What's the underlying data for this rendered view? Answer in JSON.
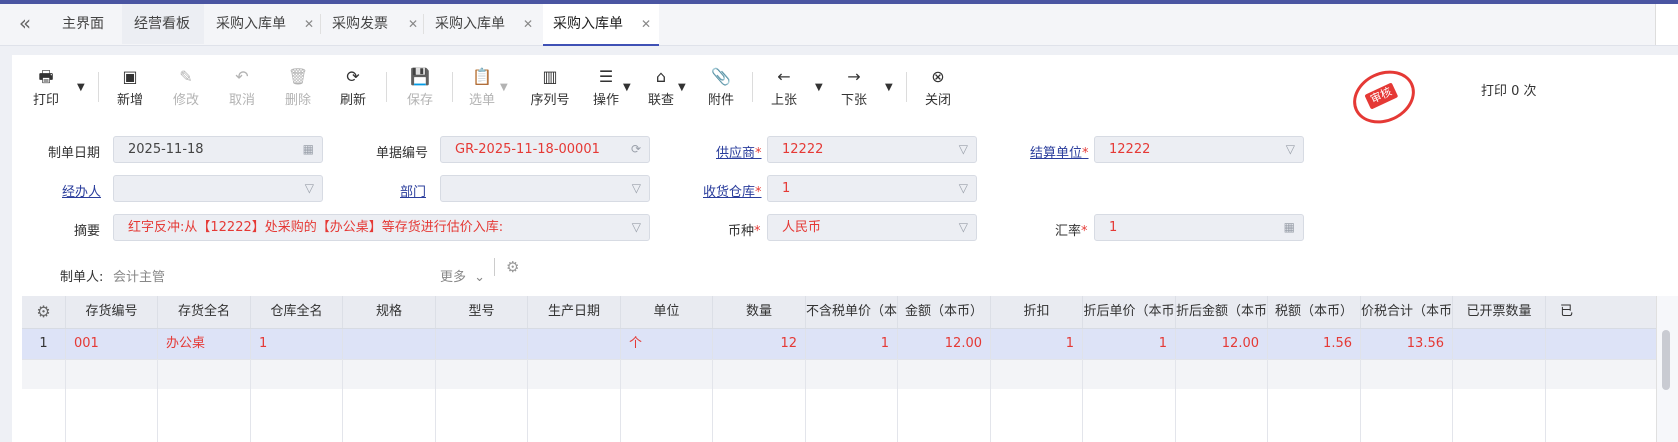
{
  "tabs": [
    {
      "label": "主界面",
      "closable": false,
      "active": false
    },
    {
      "label": "经营看板",
      "closable": false,
      "active": false
    },
    {
      "label": "采购入库单",
      "closable": true,
      "active": false
    },
    {
      "label": "采购发票",
      "closable": true,
      "active": false
    },
    {
      "label": "采购入库单",
      "closable": true,
      "active": false
    },
    {
      "label": "采购入库单",
      "closable": true,
      "active": true
    }
  ],
  "toolbar": {
    "print": "打印",
    "add": "新增",
    "edit": "修改",
    "cancel": "取消",
    "delete": "删除",
    "refresh": "刷新",
    "save": "保存",
    "select": "选单",
    "serial": "序列号",
    "operate": "操作",
    "link_query": "联查",
    "attachment": "附件",
    "prev": "上张",
    "next": "下张",
    "close": "关闭",
    "print_count": "打印 0 次"
  },
  "stamp": {
    "text": "审核"
  },
  "form": {
    "make_date_label": "制单日期",
    "make_date": "2025-11-18",
    "doc_no_label": "单据编号",
    "doc_no": "GR-2025-11-18-00001",
    "supplier_label": "供应商",
    "supplier": "12222",
    "settle_unit_label": "结算单位",
    "settle_unit": "12222",
    "handler_label": "经办人",
    "handler": "",
    "dept_label": "部门",
    "dept": "",
    "warehouse_label": "收货仓库",
    "warehouse": "1",
    "summary_label": "摘要",
    "summary": "红字反冲:从【12222】处采购的【办公桌】等存货进行估价入库:",
    "currency_label": "币种",
    "currency": "人民币",
    "rate_label": "汇率",
    "rate": "1",
    "maker_label": "制单人:",
    "maker": "会计主管",
    "more": "更多",
    "required_mark": "*"
  },
  "grid": {
    "headers": [
      "存货编号",
      "存货全名",
      "仓库全名",
      "规格",
      "型号",
      "生产日期",
      "单位",
      "数量",
      "不含税单价（本",
      "金额（本币）",
      "折扣",
      "折后单价（本币",
      "折后金额（本币",
      "税额（本币）",
      "价税合计（本币",
      "已开票数量",
      "已"
    ],
    "rows": [
      {
        "idx": "1",
        "code": "001",
        "name": "办公桌",
        "warehouse": "1",
        "spec": "",
        "model": "",
        "prod_date": "",
        "unit": "个",
        "qty": "12",
        "price": "1",
        "amount": "12.00",
        "discount": "1",
        "disc_price": "1",
        "disc_amount": "12.00",
        "tax": "1.56",
        "total": "13.56",
        "invoiced": ""
      }
    ]
  },
  "colors": {
    "accent": "#3f51b5",
    "red_text": "#e53935",
    "link": "#2a3d9c"
  }
}
